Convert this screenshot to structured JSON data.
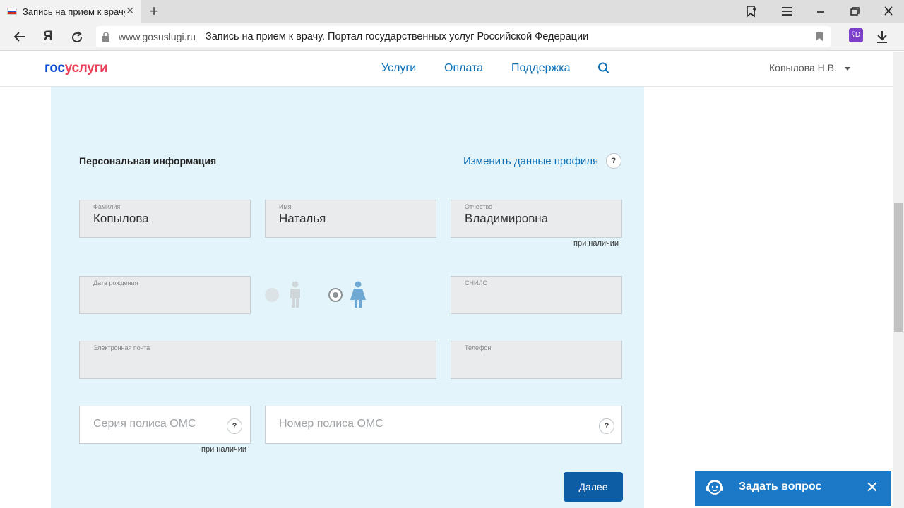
{
  "browser": {
    "tab_title": "Запись на прием к врачу",
    "tab_close": "✕",
    "new_tab": "+",
    "domain": "www.gosuslugi.ru",
    "page_title": "Запись на прием к врачу. Портал государственных услуг Российской Федерации",
    "ext_label": "ʕD"
  },
  "header": {
    "logo_part1": "гос",
    "logo_part2": "услуги",
    "nav": [
      "Услуги",
      "Оплата",
      "Поддержка"
    ],
    "user": "Копылова Н.В."
  },
  "form": {
    "section_title": "Персональная информация",
    "edit_profile": "Изменить данные профиля",
    "help": "?",
    "last_name": {
      "label": "Фамилия",
      "value": "Копылова"
    },
    "first_name": {
      "label": "Имя",
      "value": "Наталья"
    },
    "patronymic": {
      "label": "Отчество",
      "value": "Владимировна",
      "hint": "при наличии"
    },
    "birth_date": {
      "label": "Дата рождения",
      "value": ""
    },
    "gender": {
      "selected": "female"
    },
    "snils": {
      "label": "СНИЛС",
      "value": ""
    },
    "email": {
      "label": "Электронная почта",
      "value": ""
    },
    "phone": {
      "label": "Телефон",
      "value": ""
    },
    "oms_series": {
      "placeholder": "Серия полиса ОМС",
      "hint": "при наличии"
    },
    "oms_number": {
      "placeholder": "Номер полиса ОМС"
    },
    "next_button": "Далее"
  },
  "ask_widget": {
    "label": "Задать вопрос",
    "close": "✕"
  },
  "colors": {
    "brand_blue": "#0d4cd3",
    "brand_red": "#ee3f58",
    "panel_bg": "#e3f4fb",
    "button": "#0d5da5",
    "widget": "#1b79c7"
  }
}
